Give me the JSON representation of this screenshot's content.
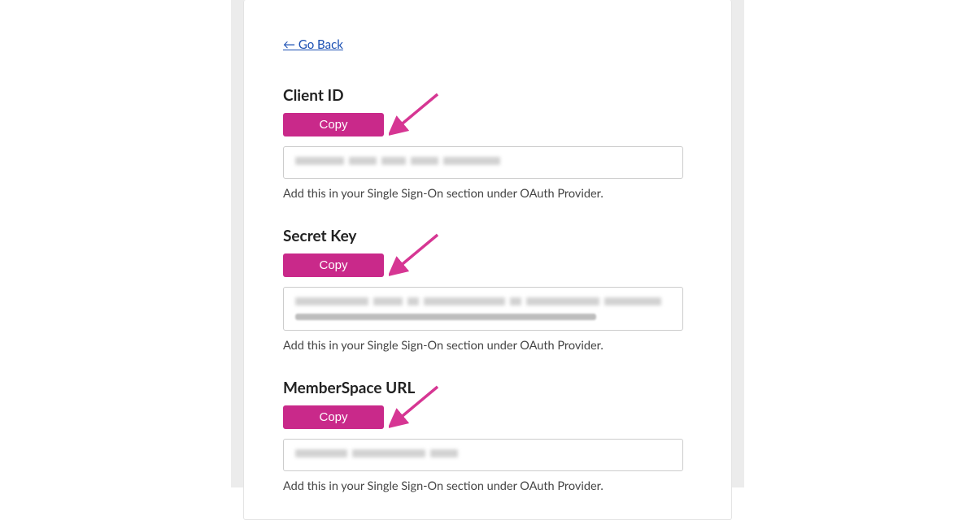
{
  "nav": {
    "go_back": "← Go Back"
  },
  "sections": {
    "client_id": {
      "title": "Client ID",
      "copy": "Copy",
      "helper": "Add this in your Single Sign-On section under OAuth Provider."
    },
    "secret_key": {
      "title": "Secret Key",
      "copy": "Copy",
      "helper": "Add this in your Single Sign-On section under OAuth Provider."
    },
    "memberspace_url": {
      "title": "MemberSpace URL",
      "copy": "Copy",
      "helper": "Add this in your Single Sign-On section under OAuth Provider."
    }
  },
  "colors": {
    "accent": "#c9298a",
    "link": "#1a4fb3",
    "arrow": "#d63693"
  }
}
